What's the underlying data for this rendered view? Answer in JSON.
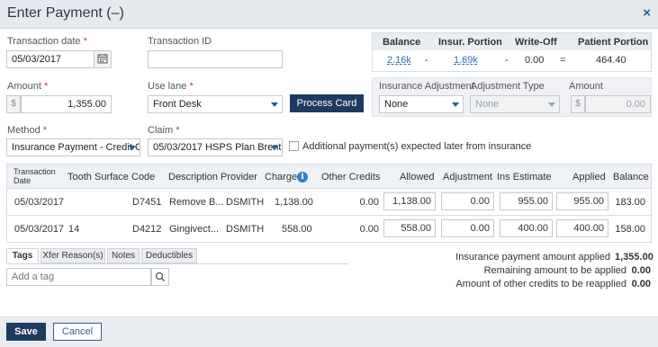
{
  "window": {
    "title": "Enter Payment (–)",
    "close_icon": "×"
  },
  "form": {
    "transaction_date": {
      "label": "Transaction date",
      "value": "05/03/2017"
    },
    "transaction_id": {
      "label": "Transaction ID",
      "value": ""
    },
    "amount": {
      "label": "Amount",
      "prefix": "$",
      "value": "1,355.00"
    },
    "use_lane": {
      "label": "Use lane",
      "value": "Front Desk"
    },
    "process_card": "Process Card",
    "method": {
      "label": "Method",
      "value": "Insurance Payment - Credit Ca"
    },
    "claim": {
      "label": "Claim",
      "value": "05/03/2017 HSPS Plan Brent"
    },
    "additional_payment": "Additional payment(s) expected later from insurance"
  },
  "insurance_summary": {
    "headers": [
      "Balance",
      "Insur. Portion",
      "Write-Off",
      "Patient Portion"
    ],
    "balance": "2.16k",
    "op1": "-",
    "insur_portion": "1.69k",
    "op2": "-",
    "write_off": "0.00",
    "op3": "=",
    "patient_portion": "464.40"
  },
  "adjustment": {
    "ins_adj_label": "Insurance Adjustment",
    "ins_adj_value": "None",
    "adj_type_label": "Adjustment Type",
    "adj_type_value": "None",
    "amount_label": "Amount",
    "amount_prefix": "$",
    "amount_value": "0.00"
  },
  "grid": {
    "headers": {
      "date_line1": "Transaction",
      "date_line2": "Date",
      "tooth": "Tooth",
      "surface": "Surface",
      "code": "Code",
      "description": "Description",
      "provider": "Provider",
      "charge": "Charge",
      "other_credits": "Other Credits",
      "allowed": "Allowed",
      "adjustment": "Adjustment",
      "ins_estimate": "Ins Estimate",
      "applied": "Applied",
      "balance": "Balance"
    },
    "rows": [
      {
        "date": "05/03/2017",
        "tooth": "",
        "code": "D7451",
        "description": "Remove B...",
        "provider": "DSMITH",
        "charge": "1,138.00",
        "other_credits": "0.00",
        "allowed": "1,138.00",
        "adjustment": "0.00",
        "ins_estimate": "955.00",
        "applied": "955.00",
        "balance": "183.00"
      },
      {
        "date": "05/03/2017",
        "tooth": "14",
        "code": "D4212",
        "description": "Gingivect...",
        "provider": "DSMITH",
        "charge": "558.00",
        "other_credits": "0.00",
        "allowed": "558.00",
        "adjustment": "0.00",
        "ins_estimate": "400.00",
        "applied": "400.00",
        "balance": "158.00"
      }
    ]
  },
  "tabs": [
    "Tags",
    "Xfer Reason(s)",
    "Notes",
    "Deductibles"
  ],
  "tag_input": {
    "placeholder": "Add a tag"
  },
  "summary": {
    "applied_label": "Insurance payment amount applied",
    "applied_value": "1,355.00",
    "remaining_label": "Remaining amount to be applied",
    "remaining_value": "0.00",
    "other_label": "Amount of other credits to be reapplied",
    "other_value": "0.00"
  },
  "footer": {
    "save": "Save",
    "cancel": "Cancel"
  },
  "colors": {
    "primary": "#1f3a5f",
    "link": "#2f6fb5",
    "required": "#c0392b"
  }
}
